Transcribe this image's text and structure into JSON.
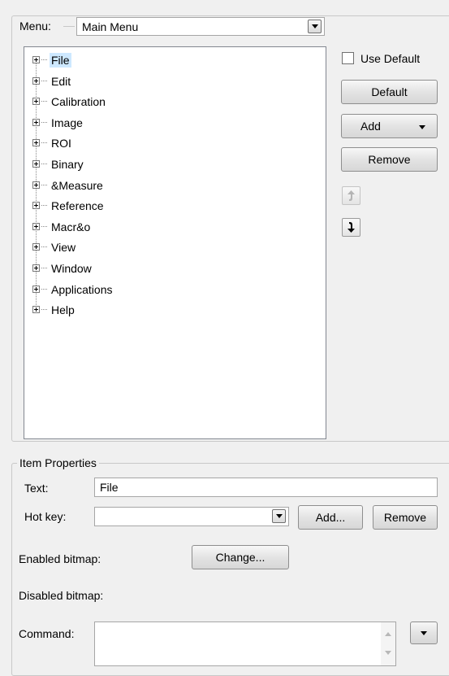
{
  "menu_group": {
    "legend": "Menu:",
    "menu_select_value": "Main Menu",
    "tree_items": [
      {
        "label": "File",
        "selected": true
      },
      {
        "label": "Edit"
      },
      {
        "label": "Calibration"
      },
      {
        "label": "Image"
      },
      {
        "label": "ROI"
      },
      {
        "label": "Binary"
      },
      {
        "label": "&Measure"
      },
      {
        "label": "Reference"
      },
      {
        "label": "Macr&o"
      },
      {
        "label": "View"
      },
      {
        "label": "Window"
      },
      {
        "label": "Applications"
      },
      {
        "label": "Help"
      }
    ],
    "use_default_label": "Use Default",
    "use_default_checked": false,
    "default_button": "Default",
    "add_button": "Add",
    "remove_button": "Remove",
    "move_up_icon": "arrow-up-icon",
    "move_down_icon": "arrow-down-icon"
  },
  "item_properties": {
    "legend": "Item Properties",
    "text_label": "Text:",
    "text_value": "File",
    "hotkey_label": "Hot key:",
    "hotkey_value": "",
    "hotkey_add_button": "Add...",
    "hotkey_remove_button": "Remove",
    "enabled_bitmap_label": "Enabled bitmap:",
    "change_button": "Change...",
    "disabled_bitmap_label": "Disabled bitmap:",
    "command_label": "Command:",
    "command_value": ""
  }
}
